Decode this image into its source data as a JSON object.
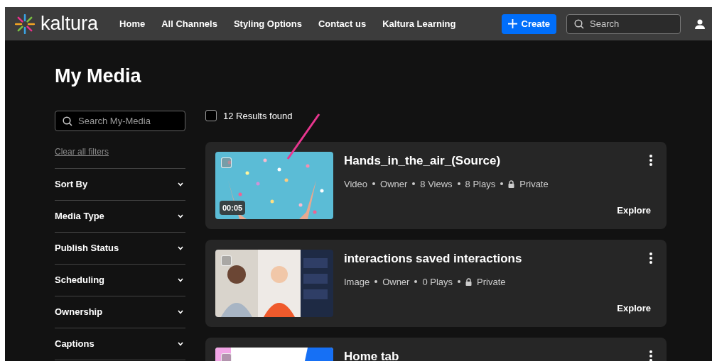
{
  "header": {
    "logo": "kaltura",
    "nav": [
      "Home",
      "All Channels",
      "Styling Options",
      "Contact us",
      "Kaltura Learning"
    ],
    "create_button": "Create",
    "search": {
      "placeholder": "Search"
    }
  },
  "page_title": "My Media",
  "sidebar": {
    "search": {
      "placeholder": "Search My-Media"
    },
    "clear_link": "Clear all filters",
    "filters": [
      {
        "label": "Sort By",
        "expanded": false
      },
      {
        "label": "Media Type",
        "expanded": false
      },
      {
        "label": "Publish Status",
        "expanded": false
      },
      {
        "label": "Scheduling",
        "expanded": false
      },
      {
        "label": "Ownership",
        "expanded": false
      },
      {
        "label": "Captions",
        "expanded": false
      }
    ]
  },
  "results": {
    "select_all": {
      "checked": false
    },
    "count": "12 Results found"
  },
  "media": [
    {
      "title": "Hands_in_the_air_(Source)",
      "thumbnail": {
        "kind": "picture"
      },
      "duration": "00:05",
      "checked": false,
      "meta": [
        "Video",
        "Owner",
        "8 Views",
        "8 Plays"
      ],
      "privacy": "Private",
      "action": "Explore"
    },
    {
      "title": "interactions saved interactions",
      "thumbnail": {
        "kind": "picture"
      },
      "checked": false,
      "meta": [
        "Image",
        "Owner",
        "0 Plays"
      ],
      "privacy": "Private",
      "action": "Explore"
    },
    {
      "title": "Home tab",
      "thumbnail": {
        "kind": "picture"
      },
      "checked": false
    }
  ]
}
